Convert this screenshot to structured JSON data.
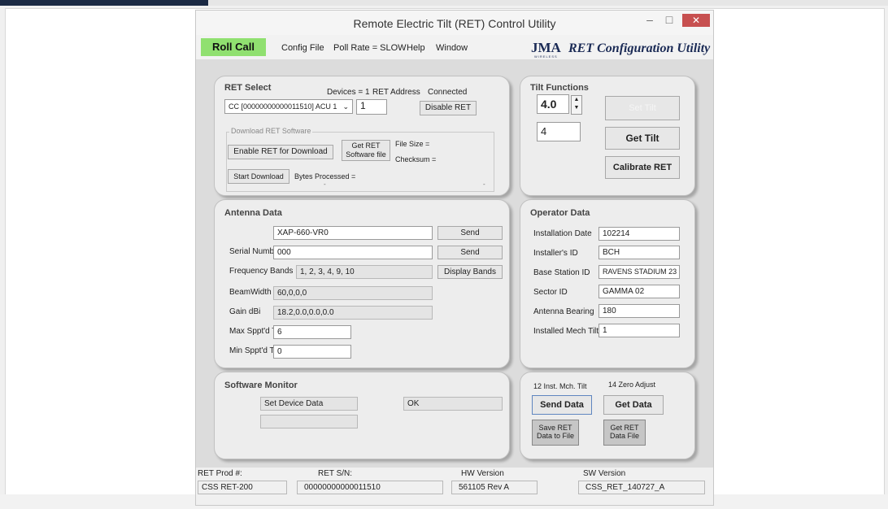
{
  "window": {
    "title": "Remote Electric Tilt (RET) Control Utility",
    "minimize_glyph": "–",
    "maximize_glyph": "□",
    "close_glyph": "✕"
  },
  "menu": {
    "roll_call": "Roll Call",
    "items": [
      "Config File",
      "Poll Rate = SLOW",
      "Help",
      "Window"
    ],
    "brand_logo": "JMA",
    "brand_sub": "WIRELESS",
    "brand_name": "RET Configuration Utility"
  },
  "ret_select": {
    "title": "RET Select",
    "devices_label": "Devices = 1",
    "ret_address_label": "RET Address",
    "connected_label": "Connected",
    "device_value": "CC [00000000000011510]  ACU  1",
    "ret_address_value": "1",
    "disable_button": "Disable RET",
    "download_group_label": "Download RET Software",
    "enable_download_button": "Enable RET for Download",
    "get_ret_file_button": "Get RET Software file",
    "file_size_label": "File Size =",
    "checksum_label": "Checksum =",
    "start_download_button": "Start Download",
    "bytes_processed_label": "Bytes Processed =",
    "progress_left": "-",
    "progress_right": "-"
  },
  "tilt": {
    "title": "Tilt Functions",
    "tilt_value": "4.0",
    "tilt_readout": "4",
    "set_tilt_button": "Set Tilt",
    "get_tilt_button": "Get Tilt",
    "calibrate_button": "Calibrate RET"
  },
  "antenna": {
    "title": "Antenna Data",
    "model_value": "XAP-660-VR0",
    "send_button_1": "Send",
    "serial_label": "Serial Number",
    "serial_value": "000",
    "send_button_2": "Send",
    "freq_label": "Frequency Bands",
    "freq_value": "1, 2, 3, 4, 9, 10",
    "display_bands_button": "Display Bands",
    "beamwidth_label": "BeamWidth",
    "beamwidth_value": "60,0,0,0",
    "gain_label": "Gain dBi",
    "gain_value": "18.2,0.0,0.0,0.0",
    "max_tilt_label": "Max Sppt'd Tilt",
    "max_tilt_value": "6",
    "min_tilt_label": "Min Sppt'd Tilt",
    "min_tilt_value": "0"
  },
  "operator": {
    "title": "Operator Data",
    "install_date_label": "Installation Date",
    "install_date_value": "102214",
    "installer_label": "Installer's ID",
    "installer_value": "BCH",
    "base_station_label": "Base Station ID",
    "base_station_value": "RAVENS STADIUM 23",
    "sector_label": "Sector ID",
    "sector_value": "GAMMA 02",
    "bearing_label": "Antenna Bearing",
    "bearing_value": "180",
    "mech_tilt_label": "Installed Mech Tilt",
    "mech_tilt_value": "1"
  },
  "software_monitor": {
    "title": "Software Monitor",
    "status_value": "Set Device Data",
    "result_value": "OK"
  },
  "data_panel": {
    "inst_mech_tilt": "12 Inst. Mch. Tilt",
    "zero_adjust": "14 Zero Adjust",
    "send_data_button": "Send Data",
    "get_data_button": "Get Data",
    "save_file_button": "Save RET Data to File",
    "get_file_button": "Get RET Data File"
  },
  "status_bar": {
    "prod_label": "RET Prod #:",
    "prod_value": "CSS RET-200",
    "sn_label": "RET S/N:",
    "sn_value": "00000000000011510",
    "hw_label": "HW Version",
    "hw_value": "561105 Rev A",
    "sw_label": "SW Version",
    "sw_value": "CSS_RET_140727_A"
  }
}
